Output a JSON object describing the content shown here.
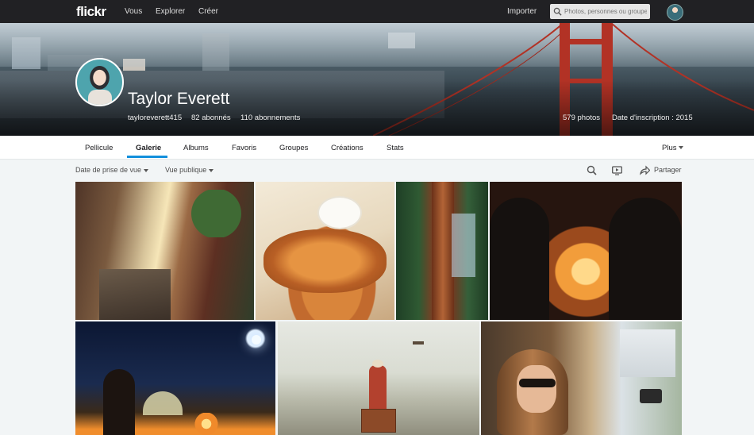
{
  "topbar": {
    "logo": "flickr",
    "links": [
      "Vous",
      "Explorer",
      "Créer"
    ],
    "import_label": "Importer",
    "search_placeholder": "Photos, personnes ou groupes"
  },
  "profile": {
    "name": "Taylor Everett",
    "username": "tayloreverett415",
    "followers": "82 abonnés",
    "following": "110 abonnements",
    "photo_count": "579 photos",
    "joined": "Date d'inscription : 2015"
  },
  "tabs": [
    "Pellicule",
    "Galerie",
    "Albums",
    "Favoris",
    "Groupes",
    "Créations",
    "Stats"
  ],
  "active_tab": "Galerie",
  "more_label": "Plus",
  "toolbar": {
    "sort_label": "Date de prise de vue",
    "view_label": "Vue publique",
    "share_label": "Partager"
  },
  "icons": {
    "search": "search-icon",
    "slideshow": "slideshow-icon",
    "share": "share-icon"
  },
  "colors": {
    "topbar": "#212124",
    "accent": "#128fdc"
  }
}
